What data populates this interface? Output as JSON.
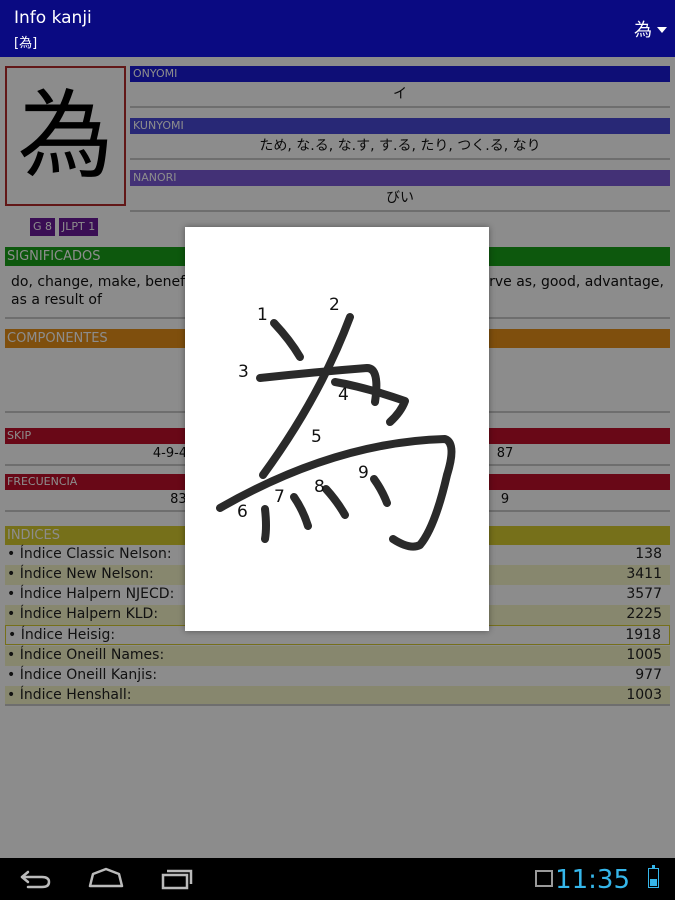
{
  "app": {
    "title": "Info kanji",
    "subtitle": "[為]",
    "spinner_value": "為"
  },
  "kanji": {
    "character": "為",
    "badges": [
      "G 8",
      "JLPT 1"
    ]
  },
  "readings": {
    "onyomi": {
      "label": "ONYOMI",
      "value": "イ",
      "color": "#1a1ad8"
    },
    "kunyomi": {
      "label": "KUNYOMI",
      "value": "ため, な.る, な.す, す.る, たり, つく.る, なり",
      "color": "#4a4ad8"
    },
    "nanori": {
      "label": "NANORI",
      "value": "びい",
      "color": "#7a5ad8"
    }
  },
  "significados": {
    "label": "SIGNIFICADOS",
    "text_left": "do, change, make, benefit,",
    "text_right": "serve as, good, advantage,",
    "text_line2": "as a result of",
    "color": "#18a018"
  },
  "componentes": {
    "label": "COMPONENTES",
    "color": "#e89018"
  },
  "skip": {
    "label": "SKIP",
    "left_value": "4-9-4",
    "right_value": "87",
    "color": "#c0102a"
  },
  "frecuencia": {
    "label": "FRECUENCIA",
    "left_value": "831",
    "right_value": "9",
    "color": "#c0102a"
  },
  "indices": {
    "label": "INDICES",
    "color": "#d8cc30",
    "rows": [
      {
        "name": "• Índice Classic Nelson:",
        "value": "138"
      },
      {
        "name": "• Índice New Nelson:",
        "value": "3411"
      },
      {
        "name": "• Índice Halpern NJECD:",
        "value": "3577"
      },
      {
        "name": "• Índice Halpern KLD:",
        "value": "2225"
      },
      {
        "name": "• Índice Heisig:",
        "value": "1918"
      },
      {
        "name": "• Índice Oneill Names:",
        "value": "1005"
      },
      {
        "name": "• Índice Oneill Kanjis:",
        "value": "977"
      },
      {
        "name": "• Índice Henshall:",
        "value": "1003"
      }
    ]
  },
  "stroke_dialog": {
    "numbers": [
      "1",
      "2",
      "3",
      "4",
      "5",
      "6",
      "7",
      "8",
      "9"
    ]
  },
  "status": {
    "clock": "11:35"
  },
  "icons": {
    "back": "back-icon",
    "home": "home-icon",
    "recents": "recents-icon",
    "gallery": "gallery-icon",
    "battery": "battery-icon",
    "spinner_caret": "chevron-down-icon"
  }
}
